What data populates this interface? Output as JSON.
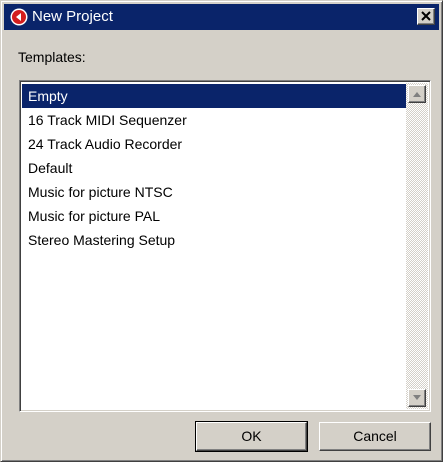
{
  "window": {
    "title": "New Project",
    "titlebar_color": "#0a246a",
    "icons": {
      "app": "cubase-app-icon",
      "close": "close-icon"
    }
  },
  "templates": {
    "label": "Templates:",
    "selected_index": 0,
    "selection_color": "#0a246a",
    "items": [
      {
        "label": "Empty"
      },
      {
        "label": "16 Track MIDI Sequenzer"
      },
      {
        "label": "24 Track Audio Recorder"
      },
      {
        "label": "Default"
      },
      {
        "label": "Music for picture NTSC"
      },
      {
        "label": "Music for picture PAL"
      },
      {
        "label": "Stereo Mastering Setup"
      }
    ]
  },
  "buttons": {
    "ok": "OK",
    "cancel": "Cancel"
  }
}
